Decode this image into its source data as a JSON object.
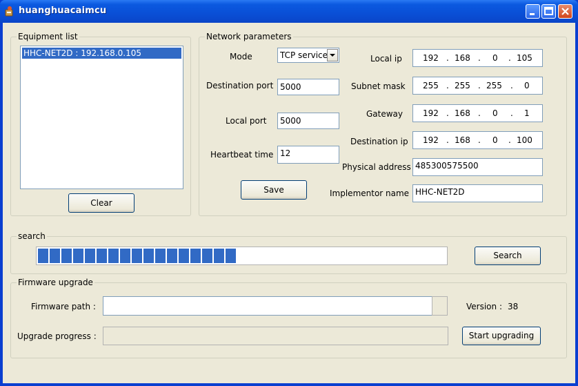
{
  "window": {
    "title": "huanghuacaimcu"
  },
  "equipment": {
    "legend": "Equipment list",
    "items": [
      {
        "label": "HHC-NET2D  :  192.168.0.105"
      }
    ],
    "clear_label": "Clear"
  },
  "network": {
    "legend": "Network parameters",
    "mode_label": "Mode",
    "mode_value": "TCP service",
    "dest_port_label": "Destination port",
    "dest_port_value": "5000",
    "local_port_label": "Local port",
    "local_port_value": "5000",
    "heartbeat_label": "Heartbeat time",
    "heartbeat_value": "12",
    "save_label": "Save",
    "local_ip_label": "Local ip",
    "local_ip": [
      "192",
      "168",
      "0",
      "105"
    ],
    "subnet_label": "Subnet mask",
    "subnet": [
      "255",
      "255",
      "255",
      "0"
    ],
    "gateway_label": "Gateway",
    "gateway": [
      "192",
      "168",
      "0",
      "1"
    ],
    "dest_ip_label": "Destination ip",
    "dest_ip": [
      "192",
      "168",
      "0",
      "100"
    ],
    "physical_label": "Physical address",
    "physical_value": "485300575500",
    "implementor_label": "Implementor name",
    "implementor_value": "HHC-NET2D"
  },
  "search": {
    "legend": "search",
    "progress_fraction": 0.5,
    "button_label": "Search"
  },
  "firmware": {
    "legend": "Firmware upgrade",
    "path_label": "Firmware path :",
    "path_value": "",
    "version_label": "Version :",
    "version_value": "38",
    "upgrade_label": "Upgrade progress :",
    "start_label": "Start upgrading"
  },
  "colors": {
    "selection": "#316ac5",
    "progress": "#316ac5",
    "titlebar": "#0a4fd6"
  }
}
